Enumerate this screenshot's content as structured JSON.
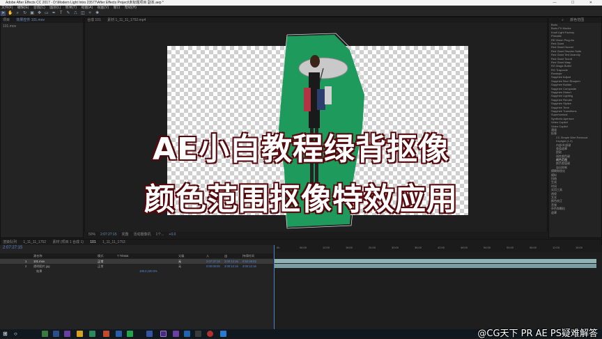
{
  "window": {
    "title": "Adobe After Effects CC 2017 - D:\\Modern Light Intro 23577\\After Effects Project\\未标题项目 副本.aep *",
    "controls": "—  ☐  ✕"
  },
  "menu": [
    "文件(F)",
    "编辑(E)",
    "合成(C)",
    "图层(L)",
    "效果(T)",
    "动画(A)",
    "视图(V)",
    "窗口",
    "帮助(H)"
  ],
  "project": {
    "tab": "项目",
    "tab2": "效果控件 101.mov",
    "item": "101.mov"
  },
  "viewer": {
    "tabs": [
      "合成 101",
      "素材 1_11_11_1752.mp4"
    ],
    "footer": [
      "50%",
      "2:07:27:15",
      "完整",
      "活动摄像机",
      "1个...",
      "+0.0"
    ]
  },
  "effects": {
    "search": "颜色范围",
    "items": [
      {
        "label": "Boris",
        "sub": false
      },
      {
        "label": "Boris FX Mocha",
        "sub": false
      },
      {
        "label": "Knoll Light Factory",
        "sub": false
      },
      {
        "label": "Primatte",
        "sub": false
      },
      {
        "label": "RE:Vision Plug-ins",
        "sub": false
      },
      {
        "label": "Red Giant",
        "sub": false
      },
      {
        "label": "Red Giant Huxnet",
        "sub": false
      },
      {
        "label": "Red Giant Shooter Suite",
        "sub": false
      },
      {
        "label": "Red Giant Text Anarchy",
        "sub": false
      },
      {
        "label": "Red Giant ToonIt",
        "sub": false
      },
      {
        "label": "Red Giant Warp",
        "sub": false
      },
      {
        "label": "RG Magic Bullet",
        "sub": false
      },
      {
        "label": "RG Trapcode",
        "sub": false
      },
      {
        "label": "Rowbyte",
        "sub": false
      },
      {
        "label": "Sapphire Adjust",
        "sub": false
      },
      {
        "label": "Sapphire Blur+Sharpen",
        "sub": false
      },
      {
        "label": "Sapphire Builder",
        "sub": false
      },
      {
        "label": "Sapphire Composite",
        "sub": false
      },
      {
        "label": "Sapphire Distort",
        "sub": false
      },
      {
        "label": "Sapphire Lighting",
        "sub": false
      },
      {
        "label": "Sapphire Render",
        "sub": false
      },
      {
        "label": "Sapphire Stylize",
        "sub": false
      },
      {
        "label": "Sapphire Time",
        "sub": false
      },
      {
        "label": "Sapphire Transitions",
        "sub": false
      },
      {
        "label": "Superluminal",
        "sub": false
      },
      {
        "label": "Synthetic Aperture",
        "sub": false
      },
      {
        "label": "Video Copilot",
        "sub": false
      },
      {
        "label": "Video Copilot",
        "sub": false
      },
      {
        "label": "通道",
        "sub": false
      },
      {
        "label": "抠像",
        "sub": false
      },
      {
        "label": "CC Simple Wire Removal",
        "sub": true
      },
      {
        "label": "Keylight (1.2)",
        "sub": true
      },
      {
        "label": "内部/外部键",
        "sub": true
      },
      {
        "label": "差值遮罩",
        "sub": true
      },
      {
        "label": "提取",
        "sub": true
      },
      {
        "label": "线性颜色键",
        "sub": true
      },
      {
        "label": "颜色范围",
        "sub": true
      },
      {
        "label": "颜色差值键",
        "sub": true
      },
      {
        "label": "溢出抑制",
        "sub": true
      },
      {
        "label": "模糊和锐化",
        "sub": false
      },
      {
        "label": "模拟",
        "sub": false
      },
      {
        "label": "扭曲",
        "sub": false
      },
      {
        "label": "生成",
        "sub": false
      },
      {
        "label": "时间",
        "sub": false
      },
      {
        "label": "实用工具",
        "sub": false
      },
      {
        "label": "透视",
        "sub": false
      },
      {
        "label": "文本",
        "sub": false
      },
      {
        "label": "颜色校正",
        "sub": false
      },
      {
        "label": "音频",
        "sub": false
      },
      {
        "label": "杂色和颗粒",
        "sub": false
      },
      {
        "label": "遮罩",
        "sub": false
      }
    ]
  },
  "timeline": {
    "tabs": [
      "渲染队列",
      "1_11_11_1752",
      "素材 (项目 1 合成 1)",
      "101",
      "1_11_11_1753"
    ],
    "timecode": "2:07:27:15",
    "columns": [
      "源名称",
      "模式",
      "T TrkMat",
      "父级",
      "入",
      "出",
      "持续时间"
    ],
    "layers": [
      {
        "num": "1",
        "name": "101.mov",
        "mode": "正常",
        "parent": "无",
        "in": "2:07:27:15",
        "out": "3:00:12:16",
        "dur": "0:52:45:02"
      },
      {
        "num": "2",
        "name": "透明图片.jpg",
        "mode": "正常",
        "parent": "无",
        "in": "0:00:00:00",
        "out": "3:00:12:16",
        "dur": "3:00:12:16"
      }
    ],
    "sublabel": "效果",
    "scale": "100.0,100.0%",
    "ruler": [
      "0h",
      "06:00",
      "12:00",
      "18:00",
      "24:00",
      "30:00",
      "36:00",
      "42:00",
      "48:00",
      "54:00",
      "00:00",
      "06:00",
      "12:00",
      "18:00"
    ]
  },
  "overlay": {
    "line1": "AE小白教程绿背抠像",
    "line2": "颜色范围抠像特效应用",
    "watermark": "@CG天下 PR AE PS疑难解答"
  },
  "colors": {
    "greenscreen": "#1e9a5c",
    "overlay_stroke": "#7a0f14"
  }
}
